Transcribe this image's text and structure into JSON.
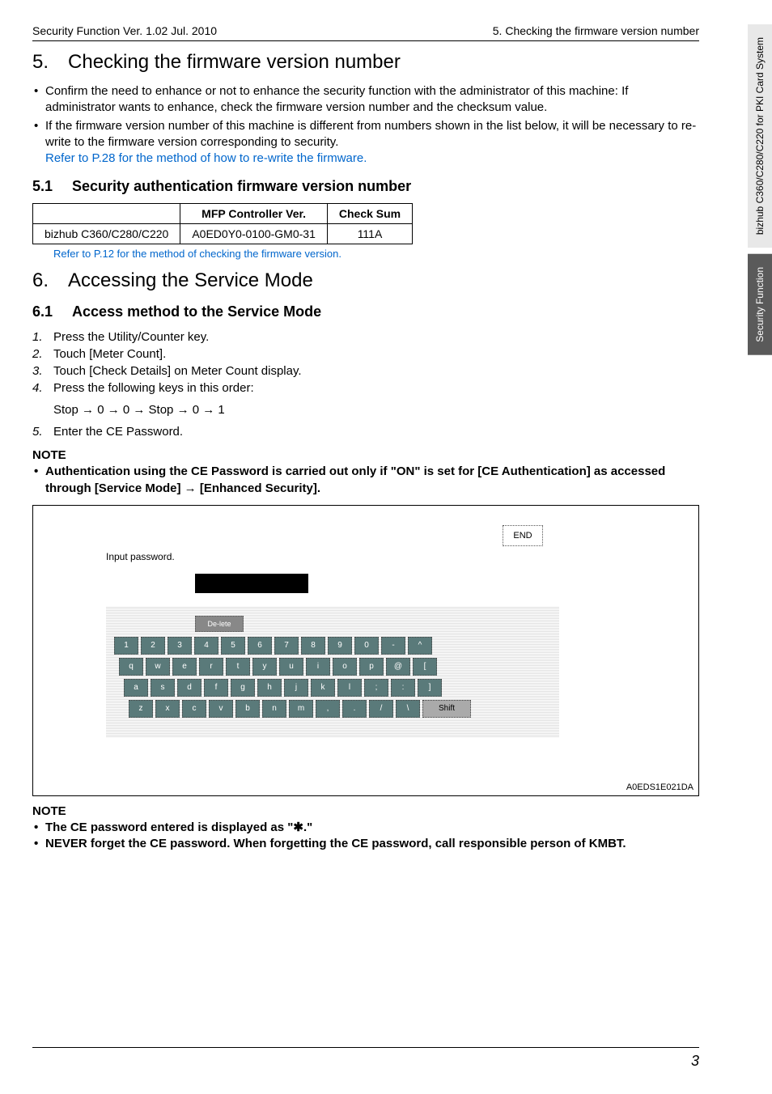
{
  "header": {
    "left": "Security Function Ver. 1.02 Jul. 2010",
    "right": "5. Checking the firmware version number"
  },
  "side_tabs": {
    "top": "bizhub C360/C280/C220\nfor PKI Card System",
    "bottom": "Security Function"
  },
  "section5": {
    "num": "5.",
    "title": "Checking the firmware version number",
    "bullets": [
      "Confirm the need to enhance or not to enhance the security function with the administrator of this machine: If administrator wants to enhance, check the firmware version number and the checksum value.",
      "If the firmware version number of this machine is different from numbers shown in the list below, it will be necessary to re-write to the firmware version corresponding to security."
    ],
    "link1": "Refer to P.28 for the method of how to re-write the firmware."
  },
  "section51": {
    "num": "5.1",
    "title": "Security authentication firmware version number",
    "table": {
      "h1": "MFP Controller Ver.",
      "h2": "Check Sum",
      "c1": "bizhub C360/C280/C220",
      "c2": "A0ED0Y0-0100-GM0-31",
      "c3": "111A"
    },
    "link": "Refer to P.12 for the method of checking the firmware version."
  },
  "section6": {
    "num": "6.",
    "title": "Accessing the Service Mode"
  },
  "section61": {
    "num": "6.1",
    "title": "Access method to the Service Mode",
    "steps": [
      {
        "n": "1.",
        "t": "Press the Utility/Counter key."
      },
      {
        "n": "2.",
        "t": "Touch [Meter Count]."
      },
      {
        "n": "3.",
        "t": "Touch [Check Details] on Meter Count display."
      },
      {
        "n": "4.",
        "t": "Press the following keys in this order:"
      },
      {
        "n": "5.",
        "t": "Enter the CE Password."
      }
    ],
    "substep": "Stop → 0 → 0 → Stop → 0 → 1"
  },
  "note1": {
    "title": "NOTE",
    "bullet": "Authentication using the CE Password is carried out only if \"ON\" is set for [CE Authentication] as accessed through [Service Mode] → [Enhanced Security]."
  },
  "screenshot": {
    "end": "END",
    "input_label": "Input password.",
    "tab": "De-lete",
    "rows": [
      [
        "1",
        "2",
        "3",
        "4",
        "5",
        "6",
        "7",
        "8",
        "9",
        "0",
        "-",
        "^"
      ],
      [
        "q",
        "w",
        "e",
        "r",
        "t",
        "y",
        "u",
        "i",
        "o",
        "p",
        "@",
        "["
      ],
      [
        "a",
        "s",
        "d",
        "f",
        "g",
        "h",
        "j",
        "k",
        "l",
        ";",
        ":",
        "]"
      ],
      [
        "z",
        "x",
        "c",
        "v",
        "b",
        "n",
        "m",
        ",",
        ".",
        "/",
        "\\"
      ]
    ],
    "shift": "Shift",
    "id": "A0EDS1E021DA"
  },
  "note2": {
    "title": "NOTE",
    "bullets": [
      "The CE password entered is displayed as \"✱.\"",
      "NEVER forget the CE password. When forgetting the CE password, call responsible person of KMBT."
    ]
  },
  "footer": {
    "page": "3"
  }
}
